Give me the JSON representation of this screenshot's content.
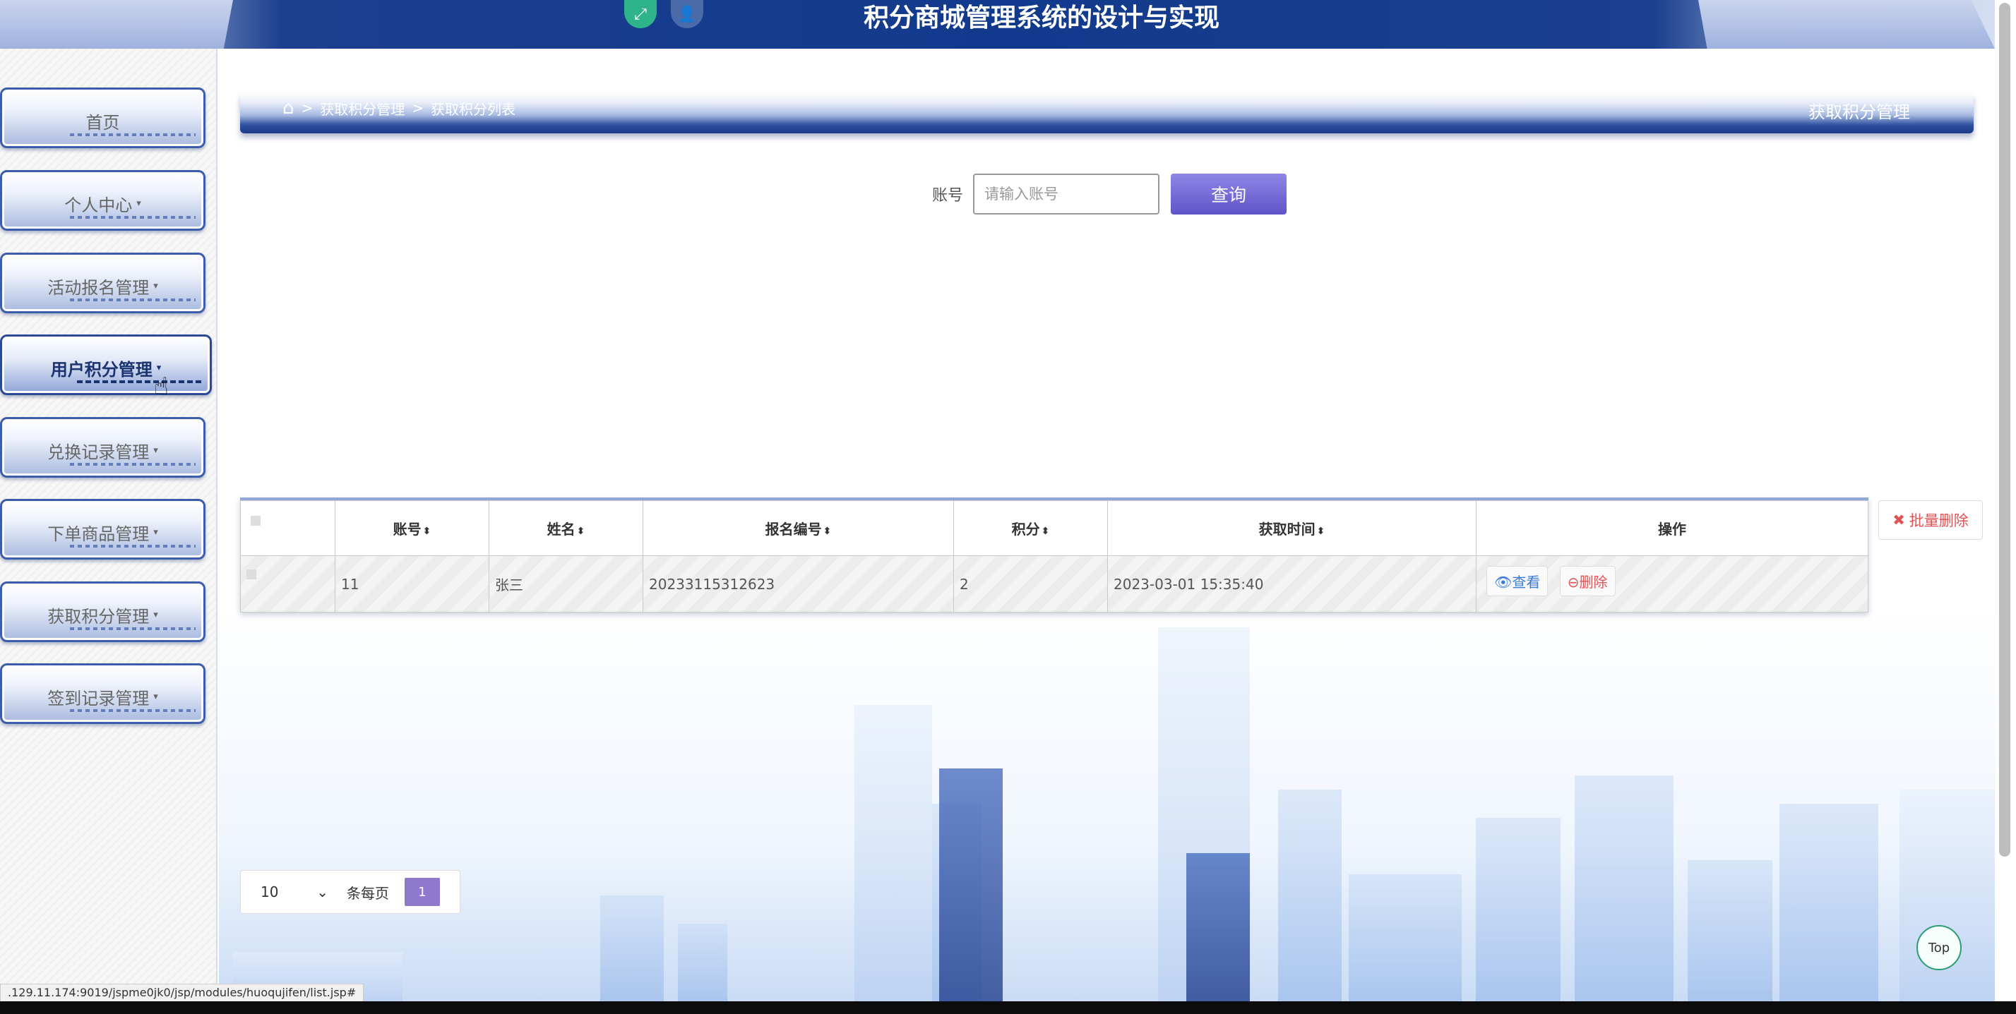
{
  "header": {
    "title": "积分商城管理系统的设计与实现",
    "icons": [
      {
        "name": "fullscreen-icon",
        "color": "#2fb38a"
      },
      {
        "name": "user-icon",
        "color": "#4a6aa8"
      }
    ]
  },
  "sidebar": {
    "items": [
      {
        "label": "首页",
        "caret": ""
      },
      {
        "label": "个人中心",
        "caret": "▾"
      },
      {
        "label": "活动报名管理",
        "caret": "▾"
      },
      {
        "label": "用户积分管理",
        "caret": "▾",
        "active": true
      },
      {
        "label": "兑换记录管理",
        "caret": "▾"
      },
      {
        "label": "下单商品管理",
        "caret": "▾"
      },
      {
        "label": "获取积分管理",
        "caret": "▾"
      },
      {
        "label": "签到记录管理",
        "caret": "▾"
      }
    ]
  },
  "breadcrumb": {
    "separator": ">",
    "items": [
      "获取积分管理",
      "获取积分列表"
    ],
    "section_title": "获取积分管理"
  },
  "search": {
    "label": "账号",
    "placeholder": "请输入账号",
    "value": "",
    "button": "查询"
  },
  "table": {
    "columns": [
      "账号",
      "姓名",
      "报名编号",
      "积分",
      "获取时间",
      "操作"
    ],
    "sort_icon": "⬍",
    "rows": [
      {
        "account": "11",
        "name": "张三",
        "signup_no": "20233115312623",
        "points": "2",
        "time": "2023-03-01 15:35:40"
      }
    ],
    "actions": {
      "view": "查看",
      "delete": "删除"
    },
    "batch_delete": "批量删除"
  },
  "pagination": {
    "page_size": "10",
    "per_page_label": "条每页",
    "current_page": "1"
  },
  "top_button": "Top",
  "status_url": ".129.11.174:9019/jspme0jk0/jsp/modules/huoqujifen/list.jsp#",
  "colors": {
    "header_blue": "#123a8c",
    "accent_purple": "#5f55c9",
    "delete_red": "#e05353",
    "view_blue": "#3a7bd5"
  }
}
